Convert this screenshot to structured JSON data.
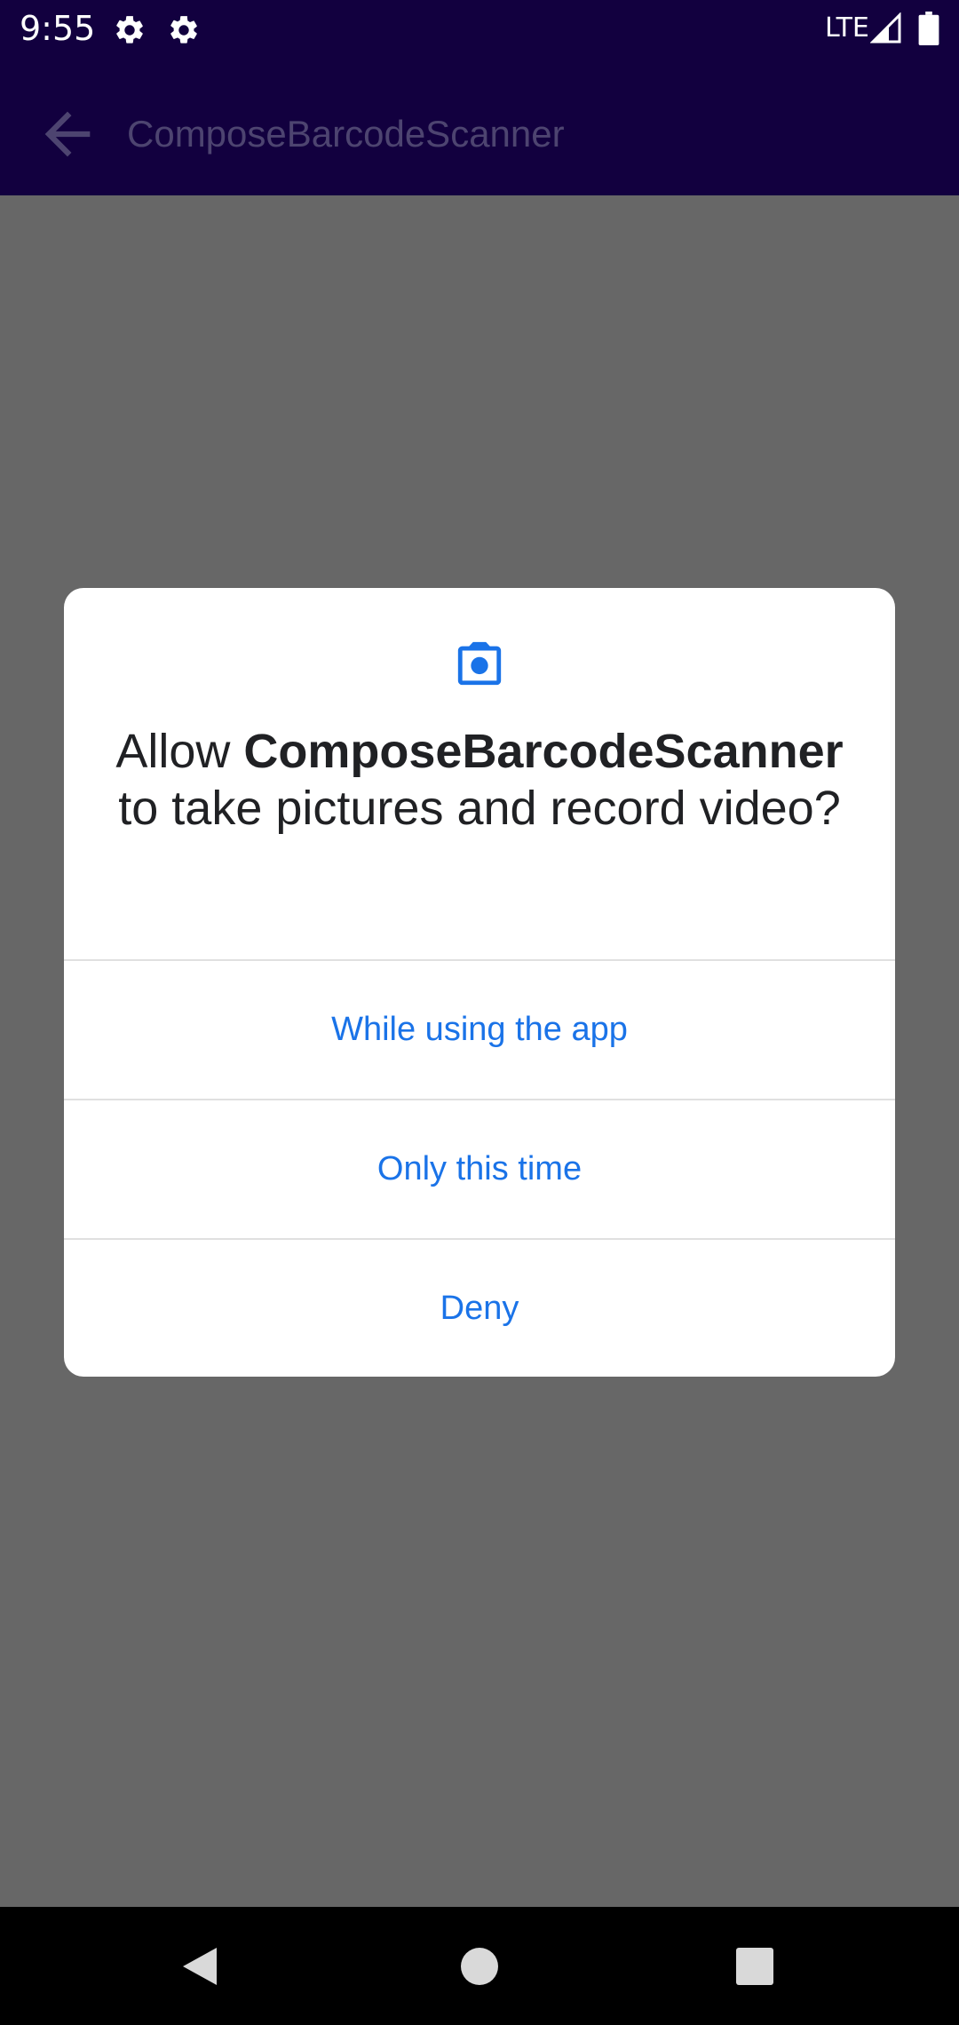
{
  "status_bar": {
    "time": "9:55",
    "network": "LTE",
    "icons": [
      "gear-icon",
      "gear-icon",
      "signal-icon",
      "battery-icon"
    ]
  },
  "app_bar": {
    "title": "ComposeBarcodeScanner",
    "back_icon": "arrow-back-icon"
  },
  "dialog": {
    "icon": "camera-icon",
    "message_prefix": "Allow ",
    "app_name": "ComposeBarcodeScanner",
    "message_suffix": " to take pictures and record video?",
    "options": [
      {
        "label": "While using the app"
      },
      {
        "label": "Only this time"
      },
      {
        "label": "Deny"
      }
    ]
  },
  "nav_bar": {
    "icons": [
      "back-triangle-icon",
      "home-circle-icon",
      "recents-square-icon"
    ]
  },
  "colors": {
    "bar_background": "#12003f",
    "scrim": "#676767",
    "accent": "#1a73e8",
    "dialog_text": "#202124"
  }
}
